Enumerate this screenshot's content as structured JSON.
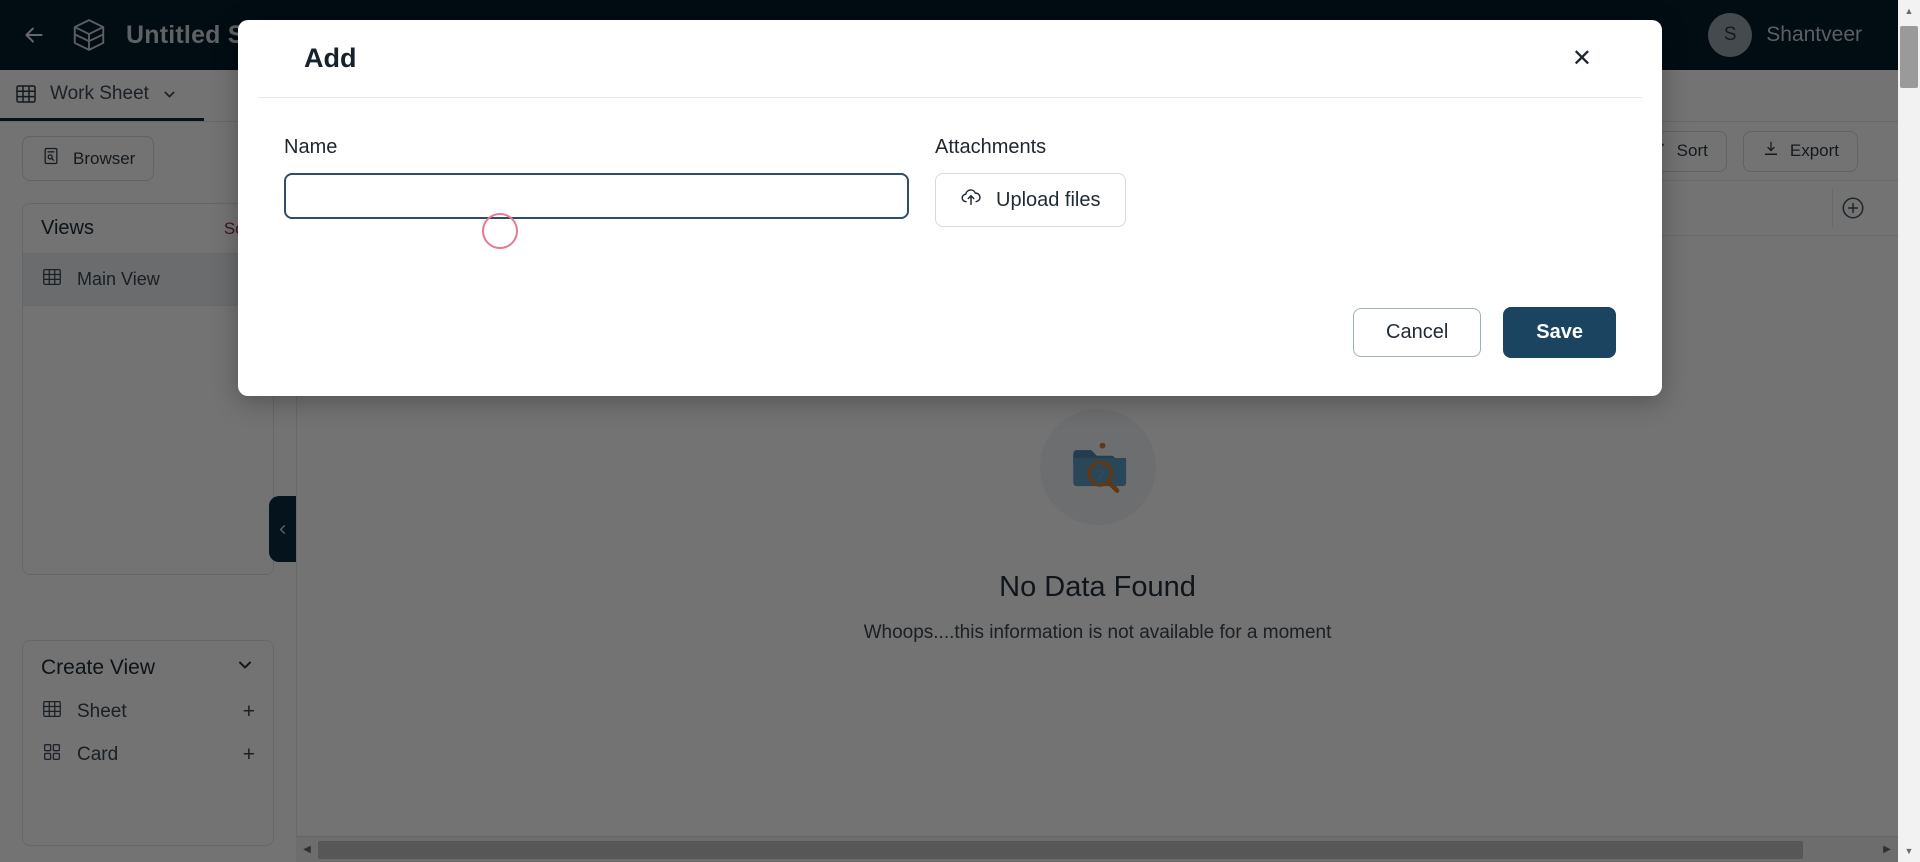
{
  "topbar": {
    "back_icon": "arrow-left-icon",
    "logo_icon": "cube-logo-icon",
    "title": "Untitled Sche",
    "user": {
      "initial": "S",
      "name": "Shantveer"
    }
  },
  "subbar": {
    "worksheet_tab": {
      "icon": "grid-icon",
      "label": "Work Sheet",
      "chevron": "chevron-down-icon"
    }
  },
  "sidebar": {
    "browser_button": {
      "icon": "browser-icon",
      "label": "Browser"
    },
    "views_panel": {
      "title": "Views",
      "sort_label": "Sort",
      "items": [
        {
          "icon": "grid-icon",
          "label": "Main View"
        }
      ]
    },
    "create_view": {
      "title": "Create View",
      "chevron": "chevron-down-icon",
      "items": [
        {
          "icon": "grid-icon",
          "label": "Sheet",
          "action": "+"
        },
        {
          "icon": "card-grid-icon",
          "label": "Card",
          "action": "+"
        }
      ]
    }
  },
  "main": {
    "toolbar": [
      {
        "icon": "sort-icon",
        "label": "Sort"
      },
      {
        "icon": "export-icon",
        "label": "Export"
      }
    ],
    "add_column_icon": "plus-circle-icon",
    "empty_state": {
      "icon": "folder-search-icon",
      "title": "No Data Found",
      "subtitle": "Whoops....this information is not available for a moment"
    }
  },
  "collapse_handle": {
    "icon": "chevron-left-icon"
  },
  "scrollbars": {
    "horizontal": {
      "left_arrow": "◀",
      "right_arrow": "▶"
    },
    "vertical": {
      "up_arrow": "▲",
      "down_arrow": "▼"
    }
  },
  "modal": {
    "title": "Add",
    "close_icon": "close-icon",
    "name_field": {
      "label": "Name",
      "value": "",
      "placeholder": ""
    },
    "attachments_field": {
      "label": "Attachments",
      "upload_icon": "upload-cloud-icon",
      "upload_label": "Upload files"
    },
    "cancel_label": "Cancel",
    "save_label": "Save"
  },
  "colors": {
    "topbar_bg": "#061b2b",
    "accent_dark": "#1b4460",
    "input_border": "#2c4e68",
    "sort_link": "#8c2b46",
    "marker": "#e8798f"
  }
}
